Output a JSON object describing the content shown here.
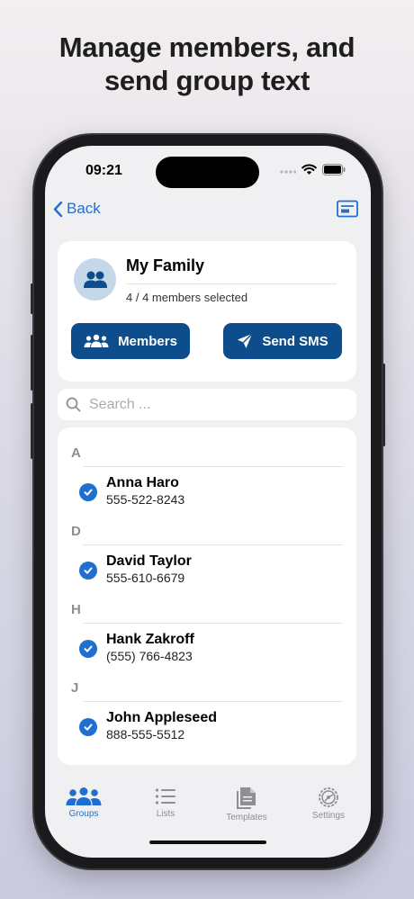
{
  "headline": {
    "line1": "Manage members, and",
    "line2": "send group text"
  },
  "status_bar": {
    "time": "09:21"
  },
  "nav": {
    "back_label": "Back"
  },
  "group": {
    "name": "My Family",
    "subtitle": "4 / 4 members selected",
    "members_button": "Members",
    "send_sms_button": "Send SMS"
  },
  "search": {
    "placeholder": "Search ..."
  },
  "contacts": [
    {
      "section": "A",
      "name": "Anna Haro",
      "phone": "555-522-8243",
      "selected": true
    },
    {
      "section": "D",
      "name": "David Taylor",
      "phone": "555-610-6679",
      "selected": true
    },
    {
      "section": "H",
      "name": "Hank Zakroff",
      "phone": "(555) 766-4823",
      "selected": true
    },
    {
      "section": "J",
      "name": "John Appleseed",
      "phone": "888-555-5512",
      "selected": true
    }
  ],
  "tabs": [
    {
      "label": "Groups",
      "icon": "groups-icon",
      "active": true
    },
    {
      "label": "Lists",
      "icon": "list-icon",
      "active": false
    },
    {
      "label": "Templates",
      "icon": "documents-icon",
      "active": false
    },
    {
      "label": "Settings",
      "icon": "gear-icon",
      "active": false
    }
  ],
  "colors": {
    "accent": "#1f6fd0",
    "button": "#0e4d8c",
    "inactive": "#8e8e93"
  }
}
